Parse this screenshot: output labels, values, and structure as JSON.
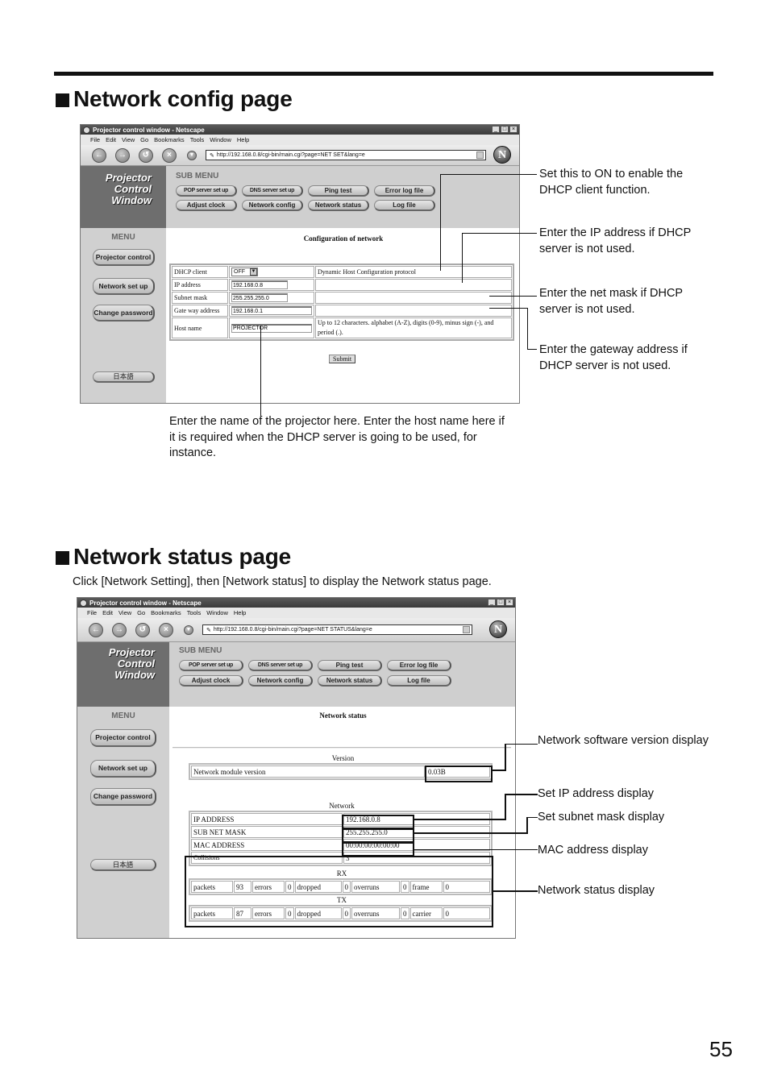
{
  "page_number": "55",
  "section1": {
    "title": "Network config page",
    "browser": {
      "window_title": "Projector control window - Netscape",
      "menu": [
        "File",
        "Edit",
        "View",
        "Go",
        "Bookmarks",
        "Tools",
        "Window",
        "Help"
      ],
      "url": "http://192.168.0.8/cgi-bin/main.cgi?page=NET SET&lang=e",
      "window_controls": [
        "_",
        "□",
        "×"
      ]
    },
    "app": {
      "brand": [
        "Projector",
        "Control",
        "Window"
      ],
      "submenu_title": "SUB MENU",
      "submenu": [
        "POP server set up",
        "DNS server set up",
        "Ping test",
        "Error log file",
        "Adjust clock",
        "Network config",
        "Network status",
        "Log file"
      ],
      "menu_title": "MENU",
      "menu": [
        "Projector control",
        "Network set up",
        "Change password"
      ],
      "language_button": "日本語",
      "content_title": "Configuration of network",
      "rows": [
        {
          "label": "DHCP client",
          "value": "OFF",
          "note": "Dynamic Host Configuration protocol"
        },
        {
          "label": "IP address",
          "value": "192.168.0.8",
          "note": ""
        },
        {
          "label": "Subnet mask",
          "value": "255.255.255.0",
          "note": ""
        },
        {
          "label": "Gate way address",
          "value": "192.168.0.1",
          "note": ""
        },
        {
          "label": "Host name",
          "value": "PROJECTOR",
          "note": "Up to 12 characters. alphabet (A-Z), digits (0-9), minus sign (-), and period (.)."
        }
      ],
      "submit_label": "Submit"
    },
    "callouts": {
      "dhcp": "Set this to ON to enable the DHCP client function.",
      "ip": "Enter the IP address if DHCP server is not used.",
      "mask": "Enter the net mask if DHCP server is not used.",
      "gateway": "Enter the gateway address if DHCP server is not used.",
      "hostname": "Enter the name of the projector here. Enter the host name here if it is required when the DHCP server is going to be used, for instance."
    }
  },
  "section2": {
    "title": "Network status page",
    "intro": "Click [Network Setting], then [Network status] to display the Network status page.",
    "browser": {
      "window_title": "Projector control window - Netscape",
      "menu": [
        "File",
        "Edit",
        "View",
        "Go",
        "Bookmarks",
        "Tools",
        "Window",
        "Help"
      ],
      "url": "http://192.168.0.8/cgi-bin/main.cgi?page=NET STATUS&lang=e",
      "window_controls": [
        "_",
        "□",
        "×"
      ]
    },
    "app": {
      "brand": [
        "Projector",
        "Control",
        "Window"
      ],
      "submenu_title": "SUB MENU",
      "submenu": [
        "POP server set up",
        "DNS server set up",
        "Ping test",
        "Error log file",
        "Adjust clock",
        "Network config",
        "Network status",
        "Log file"
      ],
      "menu_title": "MENU",
      "menu": [
        "Projector control",
        "Network set up",
        "Change password"
      ],
      "language_button": "日本語",
      "content_title": "Network status",
      "version_caption": "Version",
      "version_label": "Network module version",
      "version_value": "0.03B",
      "network_caption": "Network",
      "network_rows": [
        {
          "label": "IP ADDRESS",
          "value": "192.168.0.8"
        },
        {
          "label": "SUB NET MASK",
          "value": "255.255.255.0"
        },
        {
          "label": "MAC ADDRESS",
          "value": "00:00:00:00:00:00"
        },
        {
          "label": "Collisions",
          "value": "3"
        }
      ],
      "rx_caption": "RX",
      "rx": [
        {
          "label": "packets",
          "value": "93"
        },
        {
          "label": "errors",
          "value": "0"
        },
        {
          "label": "dropped",
          "value": "0"
        },
        {
          "label": "overruns",
          "value": "0"
        },
        {
          "label": "frame",
          "value": "0"
        }
      ],
      "tx_caption": "TX",
      "tx": [
        {
          "label": "packets",
          "value": "87"
        },
        {
          "label": "errors",
          "value": "0"
        },
        {
          "label": "dropped",
          "value": "0"
        },
        {
          "label": "overruns",
          "value": "0"
        },
        {
          "label": "carrier",
          "value": "0"
        }
      ]
    },
    "callouts": {
      "version": "Network software version display",
      "ip": "Set IP address display",
      "mask": "Set subnet mask display",
      "mac": "MAC address display",
      "status": "Network status display"
    }
  }
}
